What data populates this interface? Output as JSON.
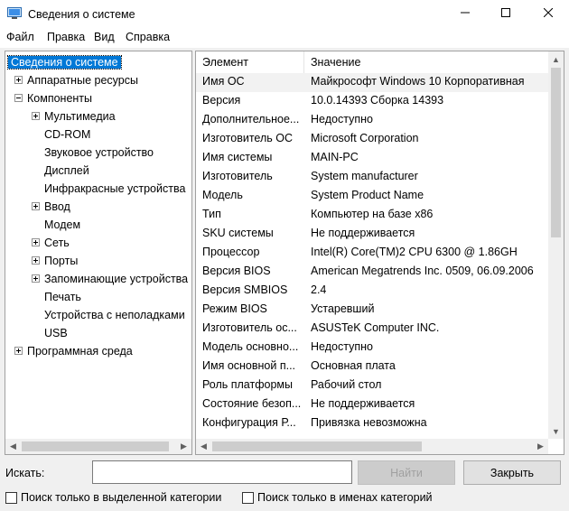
{
  "window": {
    "title": "Сведения о системе",
    "icon": "system-info-icon",
    "controls": [
      "minimize-icon",
      "maximize-icon",
      "close-icon"
    ]
  },
  "menu": [
    "Файл",
    "Правка",
    "Вид",
    "Справка"
  ],
  "tree": {
    "root": "Сведения о системе",
    "hardware": "Аппаратные ресурсы",
    "components": "Компоненты",
    "children": [
      "Мультимедиа",
      "CD-ROM",
      "Звуковое устройство",
      "Дисплей",
      "Инфракрасные устройства",
      "Ввод",
      "Модем",
      "Сеть",
      "Порты",
      "Запоминающие устройства",
      "Печать",
      "Устройства с неполадками",
      "USB"
    ],
    "software": "Программная среда"
  },
  "list": {
    "columns": [
      "Элемент",
      "Значение"
    ],
    "rows": [
      [
        "Имя ОС",
        "Майкрософт Windows 10 Корпоративная"
      ],
      [
        "Версия",
        "10.0.14393 Сборка 14393"
      ],
      [
        "Дополнительное...",
        "Недоступно"
      ],
      [
        "Изготовитель ОС",
        "Microsoft Corporation"
      ],
      [
        "Имя системы",
        "MAIN-PC"
      ],
      [
        "Изготовитель",
        "System manufacturer"
      ],
      [
        "Модель",
        "System Product Name"
      ],
      [
        "Тип",
        "Компьютер на базе x86"
      ],
      [
        "SKU системы",
        "Не поддерживается"
      ],
      [
        "Процессор",
        "Intel(R) Core(TM)2 CPU          6300  @ 1.86GH"
      ],
      [
        "Версия BIOS",
        "American Megatrends Inc. 0509, 06.09.2006"
      ],
      [
        "Версия SMBIOS",
        "2.4"
      ],
      [
        "Режим BIOS",
        "Устаревший"
      ],
      [
        "Изготовитель ос...",
        "ASUSTeK Computer INC."
      ],
      [
        "Модель основно...",
        "Недоступно"
      ],
      [
        "Имя основной п...",
        "Основная плата"
      ],
      [
        "Роль платформы",
        "Рабочий стол"
      ],
      [
        "Состояние безоп...",
        "Не поддерживается"
      ],
      [
        "Конфигурация Р...",
        "Привязка невозможна"
      ]
    ]
  },
  "search": {
    "label": "Искать:",
    "value": "",
    "find_label": "Найти",
    "close_label": "Закрыть",
    "check_selected": "Поиск только в выделенной категории",
    "check_names": "Поиск только в именах категорий"
  },
  "colors": {
    "selection": "#0078d7",
    "window": "#f0f0f0"
  }
}
